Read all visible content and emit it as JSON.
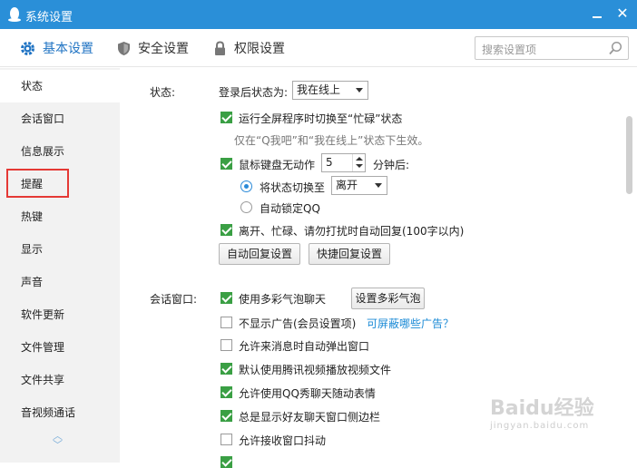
{
  "window": {
    "title": "系统设置"
  },
  "tabs": [
    {
      "label": "基本设置",
      "icon": "gear-icon",
      "active": true
    },
    {
      "label": "安全设置",
      "icon": "shield-icon"
    },
    {
      "label": "权限设置",
      "icon": "lock-icon"
    }
  ],
  "search": {
    "placeholder": "搜索设置项"
  },
  "sidebar": {
    "items": [
      {
        "label": "状态"
      },
      {
        "label": "会话窗口"
      },
      {
        "label": "信息展示"
      },
      {
        "label": "提醒"
      },
      {
        "label": "热键"
      },
      {
        "label": "显示"
      },
      {
        "label": "声音"
      },
      {
        "label": "软件更新"
      },
      {
        "label": "文件管理"
      },
      {
        "label": "文件共享"
      },
      {
        "label": "音视频通话"
      }
    ]
  },
  "status": {
    "section_label": "状态:",
    "after_login_label": "登录后状态为:",
    "after_login_value": "我在线上",
    "fullscreen_busy": "运行全屏程序时切换至“忙碌”状态",
    "fullscreen_note": "仅在“Q我吧”和“我在线上”状态下生效。",
    "idle_label": "鼠标键盘无动作",
    "idle_minutes": "5",
    "idle_suffix": "分钟后:",
    "switch_status_label": "将状态切换至",
    "switch_status_value": "离开",
    "auto_lock_label": "自动锁定QQ",
    "auto_reply_label": "离开、忙碌、请勿打扰时自动回复(100字以内)",
    "auto_reply_btn": "自动回复设置",
    "quick_reply_btn": "快捷回复设置"
  },
  "chat_window": {
    "section_label": "会话窗口:",
    "colorful_bubble": "使用多彩气泡聊天",
    "colorful_bubble_btn": "设置多彩气泡",
    "no_ads": "不显示广告(会员设置项)",
    "ads_link": "可屏蔽哪些广告？",
    "auto_popup": "允许来消息时自动弹出窗口",
    "tencent_video": "默认使用腾讯视频播放视频文件",
    "qq_show": "允许使用QQ秀聊天随动表情",
    "friend_sidebar": "总是显示好友聊天窗口侧边栏",
    "shake": "允许接收窗口抖动"
  },
  "watermark": {
    "text": "Baidu经验",
    "sub": "jingyan.baidu.com"
  },
  "colors": {
    "titlebar": "#2a8fd8",
    "accent": "#1f73c3",
    "check": "#3a9f44",
    "highlight": "#e53935"
  }
}
